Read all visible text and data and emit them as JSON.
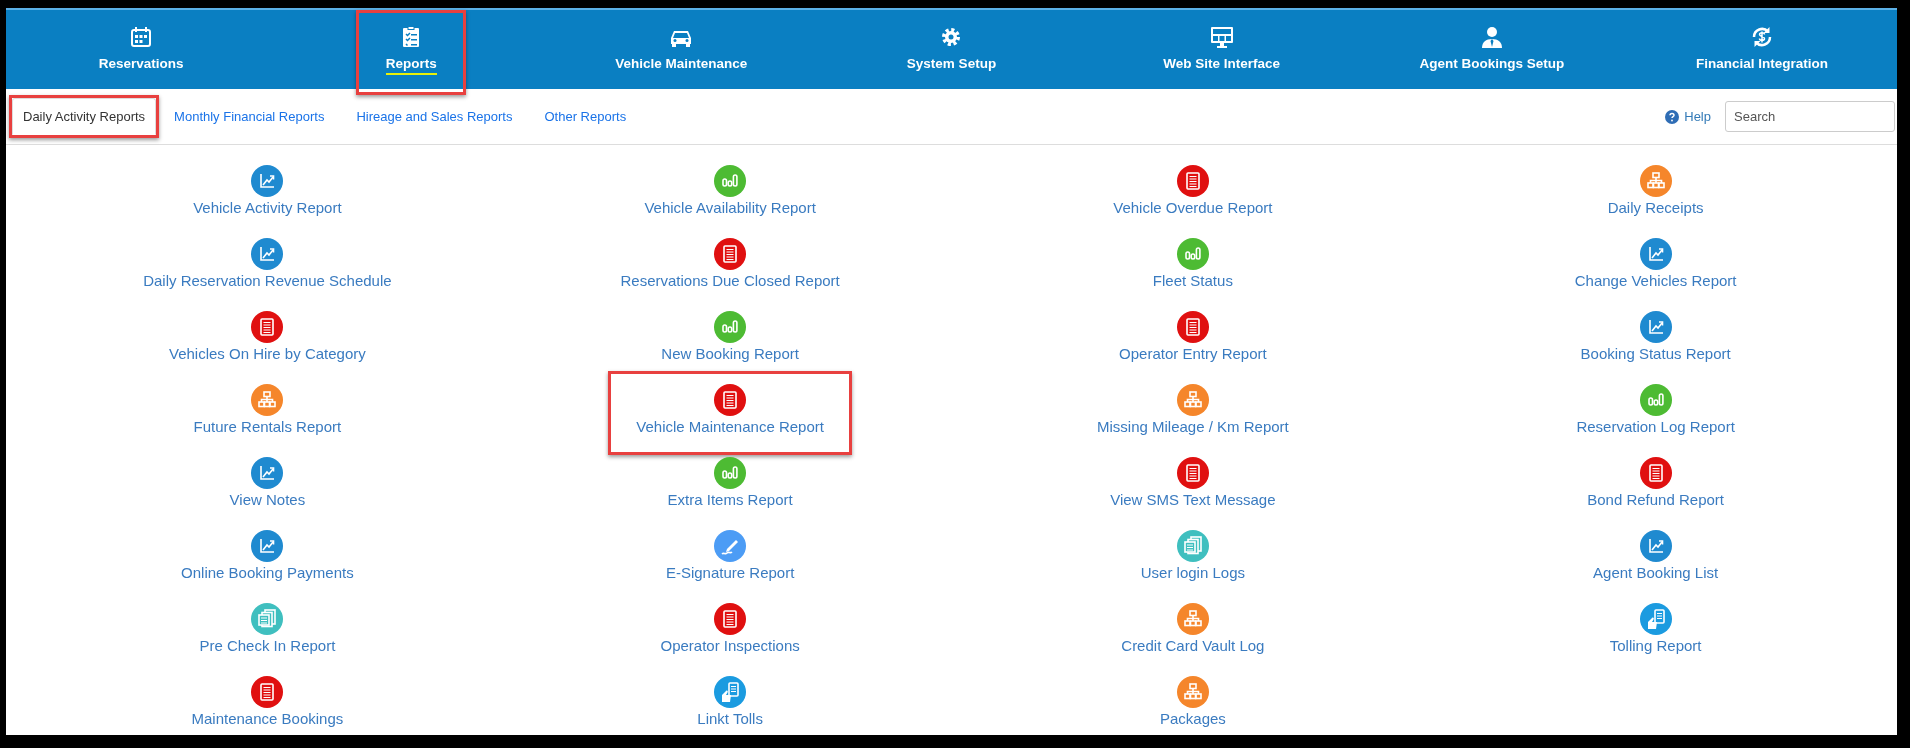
{
  "nav": [
    {
      "kind": "calendar",
      "label": "Reservations",
      "selected": false,
      "annotated": false
    },
    {
      "kind": "clipboard",
      "label": "Reports",
      "selected": true,
      "annotated": true
    },
    {
      "kind": "car",
      "label": "Vehicle Maintenance",
      "selected": false,
      "annotated": false
    },
    {
      "kind": "gear",
      "label": "System Setup",
      "selected": false,
      "annotated": false
    },
    {
      "kind": "monitor",
      "label": "Web Site Interface",
      "selected": false,
      "annotated": false
    },
    {
      "kind": "person",
      "label": "Agent Bookings Setup",
      "selected": false,
      "annotated": false
    },
    {
      "kind": "dollar",
      "label": "Financial Integration",
      "selected": false,
      "annotated": false
    }
  ],
  "tabs": [
    {
      "label": "Daily Activity Reports",
      "selected": true,
      "annotated": true
    },
    {
      "label": "Monthly Financial Reports",
      "selected": false,
      "annotated": false
    },
    {
      "label": "Hireage and Sales Reports",
      "selected": false,
      "annotated": false
    },
    {
      "label": "Other Reports",
      "selected": false,
      "annotated": false
    }
  ],
  "help": "Help",
  "search": {
    "placeholder": "Search"
  },
  "report_columns": [
    [
      {
        "kind": "chart",
        "label": "Vehicle Activity Report"
      },
      {
        "kind": "chart",
        "label": "Daily Reservation Revenue Schedule"
      },
      {
        "kind": "document",
        "label": "Vehicles On Hire by Category"
      },
      {
        "kind": "hierarchy",
        "label": "Future Rentals Report"
      },
      {
        "kind": "chart",
        "label": "View Notes"
      },
      {
        "kind": "chart",
        "label": "Online Booking Payments"
      },
      {
        "kind": "pages",
        "label": "Pre Check In Report"
      },
      {
        "kind": "document",
        "label": "Maintenance Bookings"
      }
    ],
    [
      {
        "kind": "bars",
        "label": "Vehicle Availability Report"
      },
      {
        "kind": "document",
        "label": "Reservations Due Closed Report"
      },
      {
        "kind": "bars",
        "label": "New Booking Report"
      },
      {
        "kind": "document",
        "label": "Vehicle Maintenance Report",
        "annotated": true
      },
      {
        "kind": "bars",
        "label": "Extra Items Report"
      },
      {
        "kind": "pen",
        "label": "E-Signature Report"
      },
      {
        "kind": "document",
        "label": "Operator Inspections"
      },
      {
        "kind": "hand",
        "label": "Linkt Tolls"
      }
    ],
    [
      {
        "kind": "document",
        "label": "Vehicle Overdue Report"
      },
      {
        "kind": "bars",
        "label": "Fleet Status"
      },
      {
        "kind": "document",
        "label": "Operator Entry Report"
      },
      {
        "kind": "hierarchy",
        "label": "Missing Mileage / Km Report"
      },
      {
        "kind": "document",
        "label": "View SMS Text Message"
      },
      {
        "kind": "pages",
        "label": "User login Logs"
      },
      {
        "kind": "hierarchy",
        "label": "Credit Card Vault Log"
      },
      {
        "kind": "hierarchy",
        "label": "Packages"
      }
    ],
    [
      {
        "kind": "hierarchy",
        "label": "Daily Receipts"
      },
      {
        "kind": "chart",
        "label": "Change Vehicles Report"
      },
      {
        "kind": "chart",
        "label": "Booking Status Report"
      },
      {
        "kind": "bars",
        "label": "Reservation Log Report"
      },
      {
        "kind": "document",
        "label": "Bond Refund Report"
      },
      {
        "kind": "chart",
        "label": "Agent Booking List"
      },
      {
        "kind": "hand",
        "label": "Tolling Report"
      }
    ]
  ]
}
